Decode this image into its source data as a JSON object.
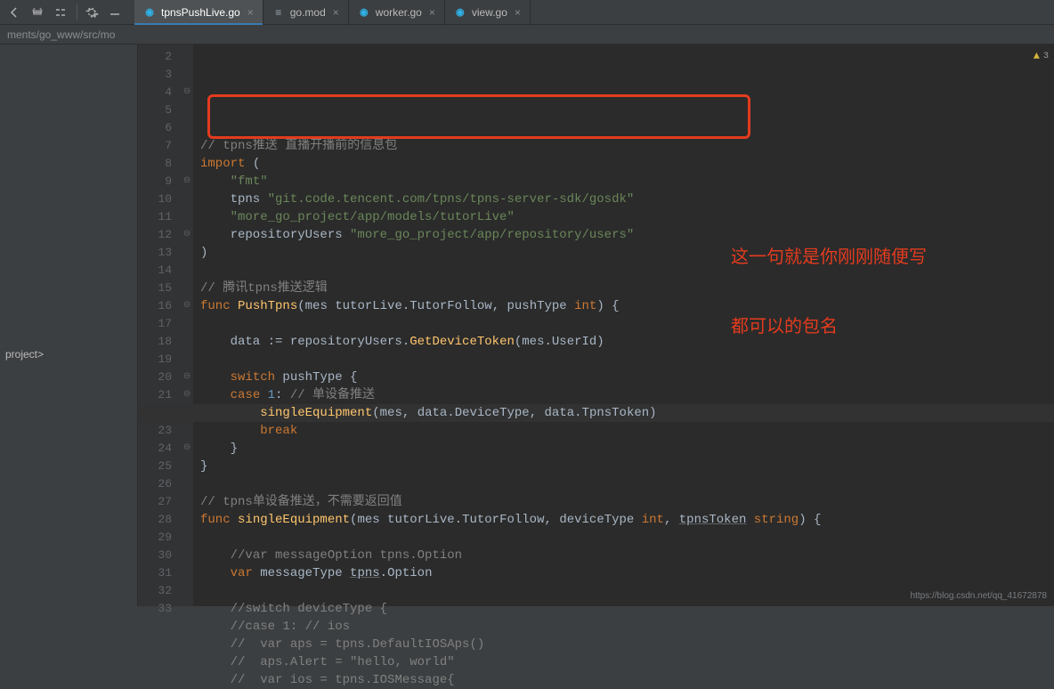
{
  "breadcrumb": "ments/go_www/src/mo",
  "sidebar": {
    "project_label": "project>"
  },
  "tabs": [
    {
      "label": "tpnsPushLive.go",
      "type": "go",
      "active": true
    },
    {
      "label": "go.mod",
      "type": "mod",
      "active": false
    },
    {
      "label": "worker.go",
      "type": "go",
      "active": false
    },
    {
      "label": "view.go",
      "type": "go",
      "active": false
    }
  ],
  "annotation": {
    "line1": "这一句就是你刚刚随便写",
    "line2": "都可以的包名"
  },
  "warning_count": "3",
  "watermark": "https://blog.csdn.net/qq_41672878",
  "lines": [
    {
      "n": 2,
      "tokens": []
    },
    {
      "n": 3,
      "tokens": [
        {
          "c": "cmt",
          "t": "// tpns推送 直播开播前的信息包"
        }
      ]
    },
    {
      "n": 4,
      "tokens": [
        {
          "c": "kw",
          "t": "import"
        },
        {
          "c": "br",
          "t": " ("
        }
      ]
    },
    {
      "n": 5,
      "tokens": [
        {
          "c": "ident",
          "t": "    "
        },
        {
          "c": "str",
          "t": "\"fmt\""
        }
      ]
    },
    {
      "n": 6,
      "tokens": [
        {
          "c": "ident",
          "t": "    tpns "
        },
        {
          "c": "str",
          "t": "\"git.code.tencent.com/tpns/tpns-server-sdk/gosdk\""
        }
      ]
    },
    {
      "n": 7,
      "tokens": [
        {
          "c": "ident",
          "t": "    "
        },
        {
          "c": "str",
          "t": "\"more_go_project/app/models/tutorLive\""
        }
      ]
    },
    {
      "n": 8,
      "tokens": [
        {
          "c": "ident",
          "t": "    repositoryUsers "
        },
        {
          "c": "str",
          "t": "\"more_go_project/app/repository/users\""
        }
      ]
    },
    {
      "n": 9,
      "tokens": [
        {
          "c": "br",
          "t": ")"
        }
      ]
    },
    {
      "n": 10,
      "tokens": []
    },
    {
      "n": 11,
      "tokens": [
        {
          "c": "cmt",
          "t": "// 腾讯tpns推送逻辑"
        }
      ]
    },
    {
      "n": 12,
      "tokens": [
        {
          "c": "kw",
          "t": "func "
        },
        {
          "c": "fn",
          "t": "PushTpns"
        },
        {
          "c": "br",
          "t": "("
        },
        {
          "c": "ident",
          "t": "mes tutorLive.TutorFollow"
        },
        {
          "c": "br",
          "t": ", "
        },
        {
          "c": "ident",
          "t": "pushType "
        },
        {
          "c": "kw",
          "t": "int"
        },
        {
          "c": "br",
          "t": ") {"
        }
      ]
    },
    {
      "n": 13,
      "tokens": []
    },
    {
      "n": 14,
      "tokens": [
        {
          "c": "ident",
          "t": "    data := repositoryUsers."
        },
        {
          "c": "fn",
          "t": "GetDeviceToken"
        },
        {
          "c": "br",
          "t": "("
        },
        {
          "c": "ident",
          "t": "mes.UserId"
        },
        {
          "c": "br",
          "t": ")"
        }
      ]
    },
    {
      "n": 15,
      "tokens": []
    },
    {
      "n": 16,
      "tokens": [
        {
          "c": "ident",
          "t": "    "
        },
        {
          "c": "kw",
          "t": "switch"
        },
        {
          "c": "ident",
          "t": " pushType "
        },
        {
          "c": "br",
          "t": "{"
        }
      ]
    },
    {
      "n": 17,
      "tokens": [
        {
          "c": "ident",
          "t": "    "
        },
        {
          "c": "kw",
          "t": "case "
        },
        {
          "c": "lit",
          "t": "1"
        },
        {
          "c": "br",
          "t": ": "
        },
        {
          "c": "cmt",
          "t": "// 单设备推送"
        }
      ]
    },
    {
      "n": 18,
      "tokens": [
        {
          "c": "ident",
          "t": "        "
        },
        {
          "c": "fn",
          "t": "singleEquipment"
        },
        {
          "c": "br",
          "t": "("
        },
        {
          "c": "ident",
          "t": "mes"
        },
        {
          "c": "br",
          "t": ", "
        },
        {
          "c": "ident",
          "t": "data.DeviceType"
        },
        {
          "c": "br",
          "t": ", "
        },
        {
          "c": "ident",
          "t": "data.TpnsToken"
        },
        {
          "c": "br",
          "t": ")"
        }
      ]
    },
    {
      "n": 19,
      "tokens": [
        {
          "c": "ident",
          "t": "        "
        },
        {
          "c": "kw",
          "t": "break"
        }
      ]
    },
    {
      "n": 20,
      "tokens": [
        {
          "c": "ident",
          "t": "    "
        },
        {
          "c": "br",
          "t": "}"
        }
      ]
    },
    {
      "n": 21,
      "tokens": [
        {
          "c": "br",
          "t": "}"
        }
      ]
    },
    {
      "n": 22,
      "tokens": [
        {
          "c": "ident",
          "t": ""
        }
      ]
    },
    {
      "n": 23,
      "tokens": [
        {
          "c": "cmt",
          "t": "// tpns单设备推送，不需要返回值"
        }
      ]
    },
    {
      "n": 24,
      "tokens": [
        {
          "c": "kw",
          "t": "func "
        },
        {
          "c": "fn",
          "t": "singleEquipment"
        },
        {
          "c": "br",
          "t": "("
        },
        {
          "c": "ident",
          "t": "mes tutorLive.TutorFollow"
        },
        {
          "c": "br",
          "t": ", "
        },
        {
          "c": "ident",
          "t": "deviceType "
        },
        {
          "c": "kw",
          "t": "int"
        },
        {
          "c": "br",
          "t": ", "
        },
        {
          "c": "ident underline",
          "t": "tpnsToken"
        },
        {
          "c": "ident",
          "t": " "
        },
        {
          "c": "kw",
          "t": "string"
        },
        {
          "c": "br",
          "t": ") {"
        }
      ]
    },
    {
      "n": 25,
      "tokens": []
    },
    {
      "n": 26,
      "tokens": [
        {
          "c": "ident",
          "t": "    "
        },
        {
          "c": "cmt",
          "t": "//var messageOption tpns.Option"
        }
      ]
    },
    {
      "n": 27,
      "tokens": [
        {
          "c": "ident",
          "t": "    "
        },
        {
          "c": "kw",
          "t": "var"
        },
        {
          "c": "ident",
          "t": " messageType "
        },
        {
          "c": "pkg underline",
          "t": "tpns"
        },
        {
          "c": "br",
          "t": "."
        },
        {
          "c": "typ",
          "t": "Option"
        }
      ]
    },
    {
      "n": 28,
      "tokens": []
    },
    {
      "n": 29,
      "tokens": [
        {
          "c": "ident",
          "t": "    "
        },
        {
          "c": "cmt",
          "t": "//switch deviceType {"
        }
      ]
    },
    {
      "n": 30,
      "tokens": [
        {
          "c": "ident",
          "t": "    "
        },
        {
          "c": "cmt",
          "t": "//case 1: // ios"
        }
      ]
    },
    {
      "n": 31,
      "tokens": [
        {
          "c": "ident",
          "t": "    "
        },
        {
          "c": "cmt",
          "t": "//  var aps = tpns.DefaultIOSAps()"
        }
      ]
    },
    {
      "n": 32,
      "tokens": [
        {
          "c": "ident",
          "t": "    "
        },
        {
          "c": "cmt",
          "t": "//  aps.Alert = \"hello, world\""
        }
      ]
    },
    {
      "n": 33,
      "tokens": [
        {
          "c": "ident",
          "t": "    "
        },
        {
          "c": "cmt",
          "t": "//  var ios = tpns.IOSMessage{"
        }
      ]
    }
  ]
}
